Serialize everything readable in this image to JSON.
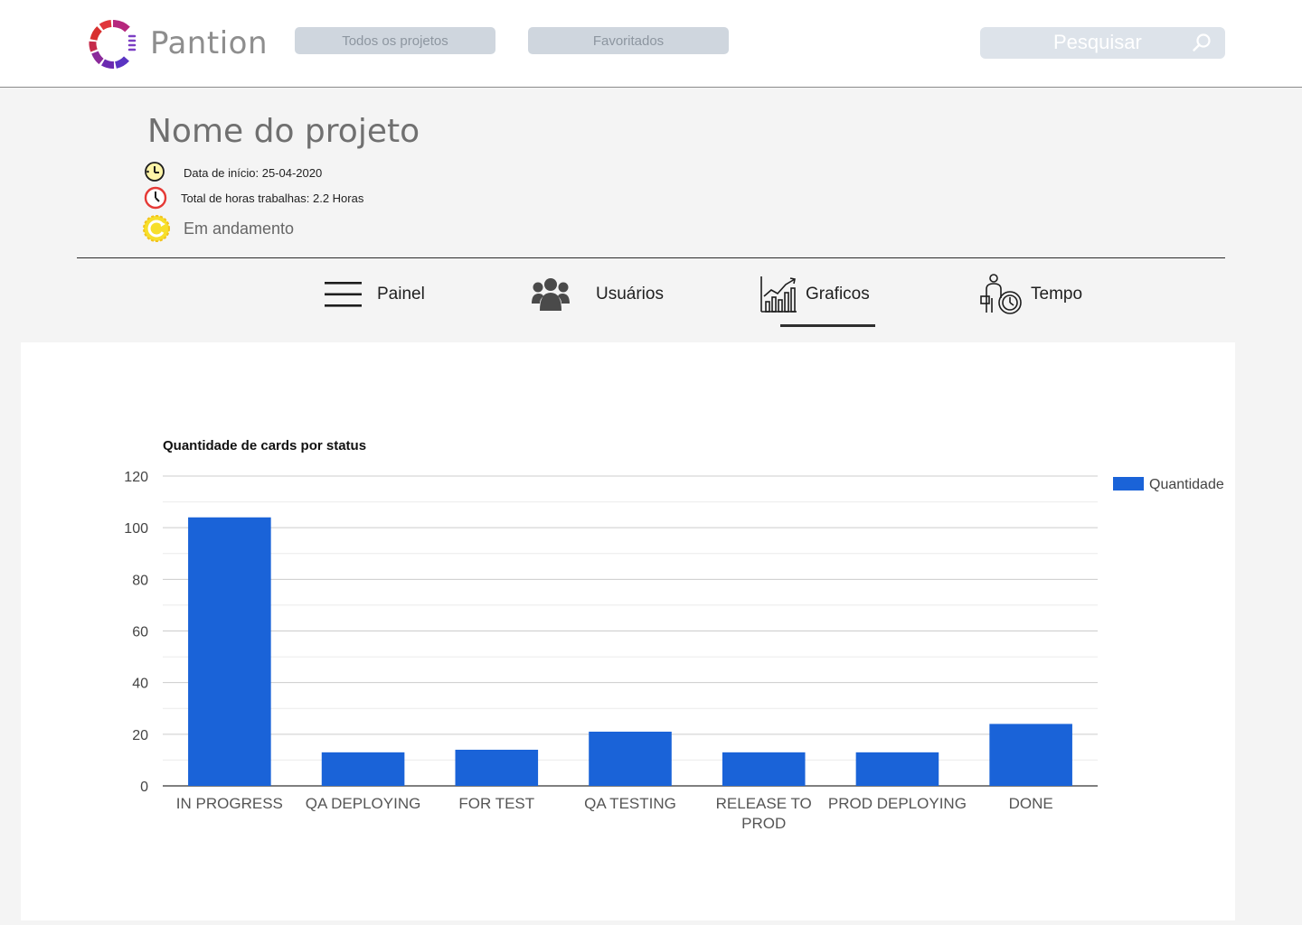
{
  "app": {
    "name": "Pantion"
  },
  "nav": {
    "all_projects": "Todos os projetos",
    "favorites": "Favoritados",
    "search_placeholder": "Pesquisar"
  },
  "project": {
    "title": "Nome do projeto",
    "start_date": "Data de início: 25-04-2020",
    "total_hours": "Total de horas trabalhas: 2.2 Horas",
    "status": "Em andamento"
  },
  "tabs": [
    {
      "label": "Painel",
      "icon": "hamburger-icon"
    },
    {
      "label": "Usuários",
      "icon": "users-icon"
    },
    {
      "label": "Graficos",
      "icon": "chart-growth-icon",
      "active": true
    },
    {
      "label": "Tempo",
      "icon": "person-clock-icon"
    }
  ],
  "colors": {
    "bar": "#1a63d8",
    "nav_pill": "#cfd6de",
    "accent_yellow": "#f2d21b",
    "accent_red": "#e53935"
  },
  "chart_data": {
    "type": "bar",
    "title": "Quantidade de cards por status",
    "categories": [
      "IN PROGRESS",
      "QA DEPLOYING",
      "FOR TEST",
      "QA TESTING",
      "RELEASE TO PROD",
      "PROD DEPLOYING",
      "DONE"
    ],
    "series": [
      {
        "name": "Quantidade",
        "values": [
          104,
          13,
          14,
          21,
          13,
          13,
          24
        ]
      }
    ],
    "ylim": [
      0,
      120
    ],
    "yticks": [
      0,
      20,
      40,
      60,
      80,
      100,
      120
    ],
    "grid": true,
    "legend": "right"
  }
}
